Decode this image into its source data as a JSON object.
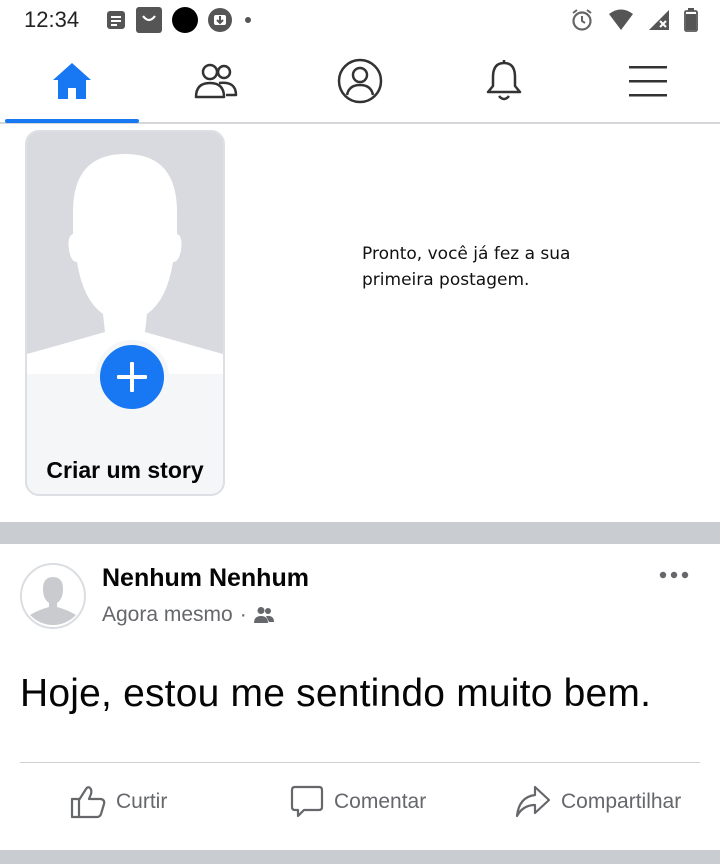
{
  "status_bar": {
    "time": "12:34",
    "left_icons": [
      "notes-icon",
      "shop-bag-icon",
      "black-circle-icon",
      "download-icon",
      "dot-icon"
    ],
    "right_icons": [
      "alarm-icon",
      "wifi-icon",
      "signal-icon",
      "battery-icon"
    ]
  },
  "nav": {
    "tabs": [
      {
        "name": "home",
        "icon": "home-icon",
        "active": true
      },
      {
        "name": "friends",
        "icon": "friends-icon",
        "active": false
      },
      {
        "name": "profile",
        "icon": "profile-icon",
        "active": false
      },
      {
        "name": "notifications",
        "icon": "bell-icon",
        "active": false
      },
      {
        "name": "menu",
        "icon": "hamburger-menu-icon",
        "active": false
      }
    ],
    "accent_color": "#1877f2"
  },
  "stories": {
    "create_label": "Criar um story"
  },
  "confirmation_text": "Pronto, você já fez a sua primeira postagem.",
  "post": {
    "author": "Nenhum Nenhum",
    "timestamp": "Agora mesmo",
    "separator": "·",
    "audience_icon": "friends-audience-icon",
    "text": "Hoje, estou me sentindo muito bem.",
    "actions": {
      "like": "Curtir",
      "comment": "Comentar",
      "share": "Compartilhar"
    }
  }
}
